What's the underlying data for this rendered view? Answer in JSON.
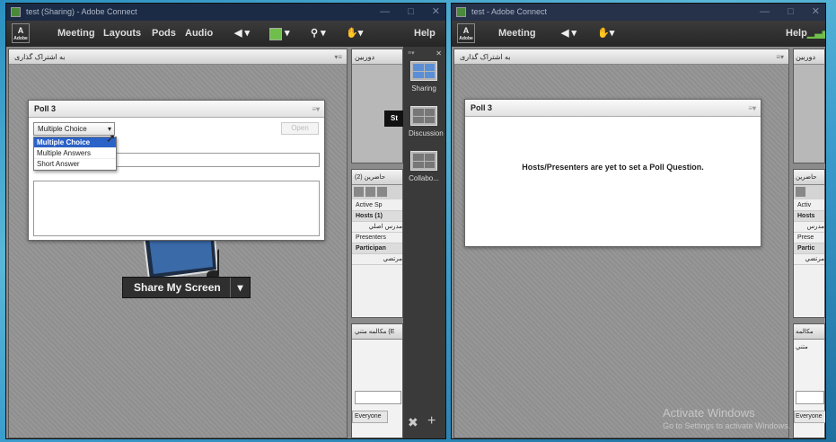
{
  "left_window": {
    "title": "test (Sharing) - Adobe Connect",
    "menu": [
      "Meeting",
      "Layouts",
      "Pods",
      "Audio"
    ],
    "help": "Help",
    "logo_text": "Adobe",
    "share_pod_title": "به اشتراک گذاری",
    "poll": {
      "title": "Poll 3",
      "type_selected": "Multiple Choice",
      "open_button": "Open",
      "options": [
        "Multiple Choice",
        "Multiple Answers",
        "Short Answer"
      ]
    },
    "share_button": "Share My Screen",
    "video_pod_title": "دوربين",
    "attendees": {
      "title": "حاضرين",
      "count": "(2)",
      "rows": [
        "Active Sp",
        "Hosts (1)",
        "مدرس اصلي",
        "Presenters",
        "Participan",
        "مرتضي"
      ]
    },
    "chat": {
      "title": "مكالمه متني",
      "suffix": "(E",
      "everyone_button": "Everyone"
    },
    "tray": {
      "items": [
        "Sharing",
        "Discussion",
        "Collabo..."
      ]
    }
  },
  "right_window": {
    "title": "test - Adobe Connect",
    "menu": [
      "Meeting"
    ],
    "help": "Help",
    "logo_text": "Adobe",
    "share_pod_title": "به اشتراک گذاری",
    "poll": {
      "title": "Poll 3",
      "message": "Hosts/Presenters are yet to set a Poll Question."
    },
    "video_pod_title": "دوربين",
    "attendees": {
      "title": "حاضرين",
      "rows": [
        "Activ",
        "Hosts",
        "مدرس",
        "Prese",
        "Partic",
        "مرتضي"
      ]
    },
    "chat": {
      "title": "مكالمه متني",
      "everyone_button": "Everyone"
    }
  },
  "watermark": {
    "line1": "Activate Windows",
    "line2": "Go to Settings to activate Windows."
  }
}
